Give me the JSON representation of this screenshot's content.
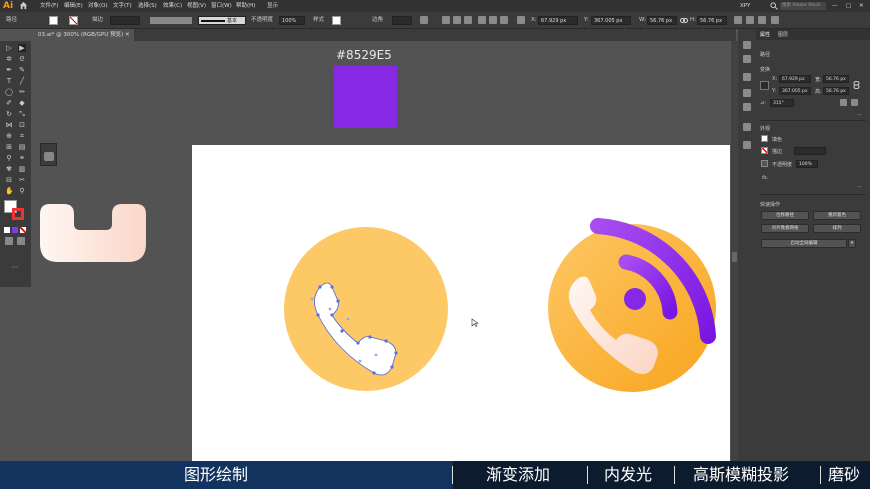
{
  "app": {
    "logo": "Ai"
  },
  "menu": [
    "文件(F)",
    "编辑(E)",
    "对象(O)",
    "文字(T)",
    "选择(S)",
    "效果(C)",
    "视图(V)",
    "窗口(W)",
    "帮助(H)",
    "显示"
  ],
  "workspace": {
    "name": "XPY",
    "search_placeholder": "搜索 Adobe Stock"
  },
  "control": {
    "selection": "路径",
    "stroke_label": "描边",
    "brush": "基本",
    "opacity_label": "不透明度",
    "opacity": "100%",
    "style_label": "样式",
    "corner_label": "边角",
    "x": "67.929 px",
    "y": "367.005 px",
    "w": "56.76 px",
    "h": "56.76 px"
  },
  "document": {
    "tab_label": "03.ai* @ 300% (RGB/GPU 预览)"
  },
  "canvas": {
    "hex_label": "#8529E5"
  },
  "colors": {
    "purple": "#8529E5",
    "yellow": "#FDC866",
    "orange": "#F8A41C"
  },
  "panel": {
    "tabs": [
      "属性",
      "图层"
    ],
    "section_path": "路径",
    "section_transform": "变换",
    "x": "67.929 px",
    "y": "367.005 px",
    "w": "56.76 px",
    "h": "56.76 px",
    "angle": "315°",
    "section_appearance": "外观",
    "fill_label": "填色",
    "stroke_label": "描边",
    "opacity_label": "不透明度",
    "opacity": "100%",
    "fx": "fx.",
    "section_quick": "快速操作",
    "btn_offset": "位移路径",
    "btn_recolor": "重新着色",
    "btn_align": "对齐像素网格",
    "btn_arrange": "排列",
    "btn_trace": "启动全局编辑"
  },
  "subtitles": [
    "图形绘制",
    "渐变添加",
    "内发光",
    "高斯模糊投影",
    "磨砂"
  ]
}
